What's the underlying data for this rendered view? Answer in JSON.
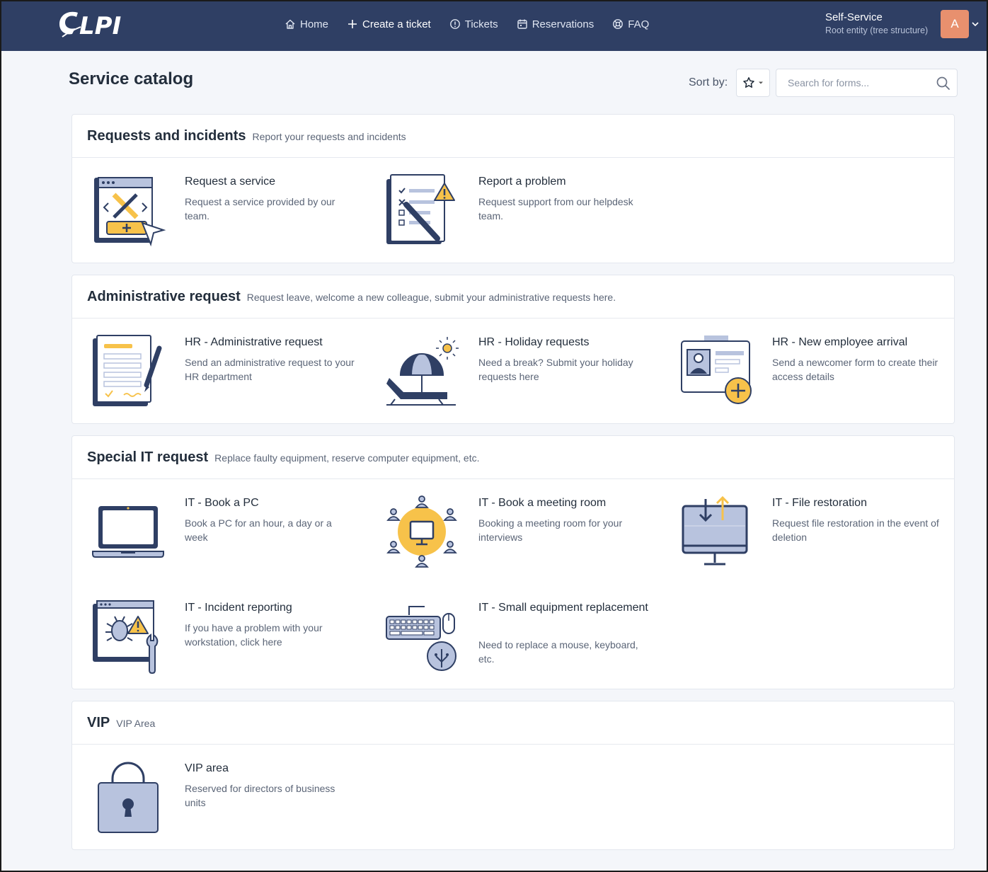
{
  "header": {
    "logo_text": "GLPI",
    "nav": [
      {
        "label": "Home",
        "icon": "home-icon"
      },
      {
        "label": "Create a ticket",
        "icon": "plus-icon"
      },
      {
        "label": "Tickets",
        "icon": "alert-circle-icon"
      },
      {
        "label": "Reservations",
        "icon": "calendar-icon"
      },
      {
        "label": "FAQ",
        "icon": "lifebuoy-icon"
      }
    ],
    "user": {
      "name": "Self-Service",
      "entity": "Root entity (tree structure)",
      "avatar_letter": "A"
    }
  },
  "page": {
    "title": "Service catalog",
    "sort_label": "Sort by:",
    "search_placeholder": "Search for forms..."
  },
  "categories": [
    {
      "title": "Requests and incidents",
      "subtitle": "Report your requests and incidents",
      "items": [
        {
          "name": "Request a service",
          "desc": "Request a service provided by our team."
        },
        {
          "name": "Report a problem",
          "desc": "Request support from our helpdesk team."
        }
      ]
    },
    {
      "title": "Administrative request",
      "subtitle": "Request leave, welcome a new colleague, submit your administrative requests here.",
      "items": [
        {
          "name": "HR - Administrative request",
          "desc": "Send an administrative request to your HR department"
        },
        {
          "name": "HR - Holiday requests",
          "desc": "Need a break? Submit your holiday requests here"
        },
        {
          "name": "HR - New employee arrival",
          "desc": "Send a newcomer form to create their access details"
        }
      ]
    },
    {
      "title": "Special IT request",
      "subtitle": "Replace faulty equipment, reserve computer equipment, etc.",
      "items": [
        {
          "name": "IT - Book a PC",
          "desc": "Book a PC for an hour, a day or a week"
        },
        {
          "name": "IT - Book a meeting room",
          "desc": "Booking a meeting room for your interviews"
        },
        {
          "name": "IT - File restoration",
          "desc": "Request file restoration in the event of deletion"
        },
        {
          "name": "IT - Incident reporting",
          "desc": "If you have a problem with your workstation, click here"
        },
        {
          "name": "IT - Small equipment replacement",
          "desc": "Need to replace a mouse, keyboard, etc."
        }
      ]
    },
    {
      "title": "VIP",
      "subtitle": "VIP Area",
      "items": [
        {
          "name": "VIP area",
          "desc": "Reserved for directors of business units"
        }
      ]
    }
  ],
  "colors": {
    "navbar": "#2f3f64",
    "accent": "#f7c24a",
    "illustration_dark": "#2f3f64",
    "illustration_light": "#b8c3de"
  }
}
